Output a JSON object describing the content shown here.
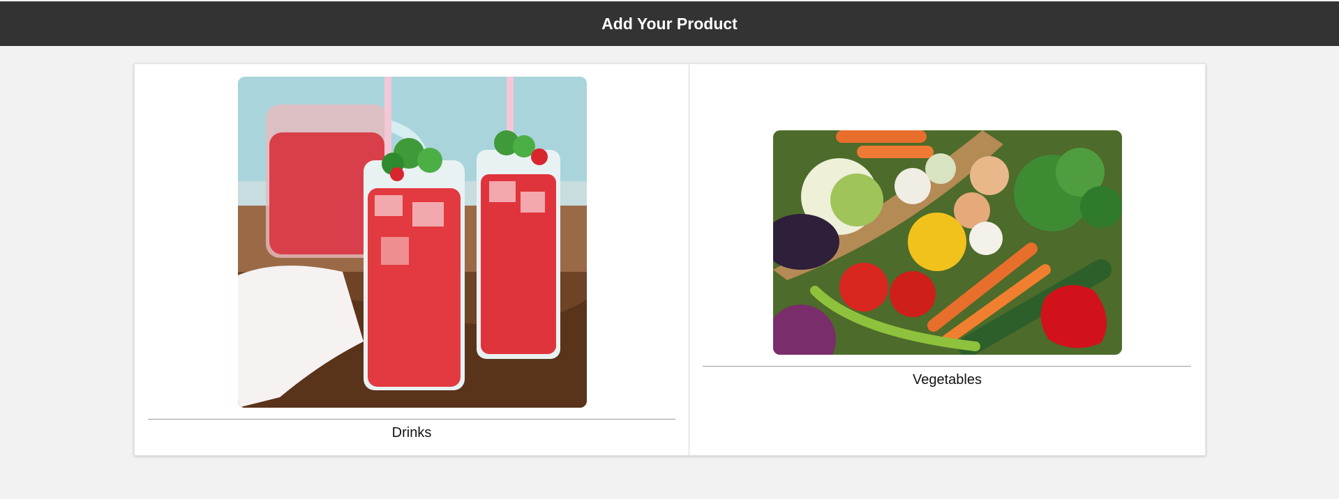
{
  "header": {
    "title": "Add Your Product",
    "background": "#333333"
  },
  "categories": [
    {
      "label": "Drinks",
      "image": "drinks-photo"
    },
    {
      "label": "Vegetables",
      "image": "vegetables-photo"
    }
  ]
}
